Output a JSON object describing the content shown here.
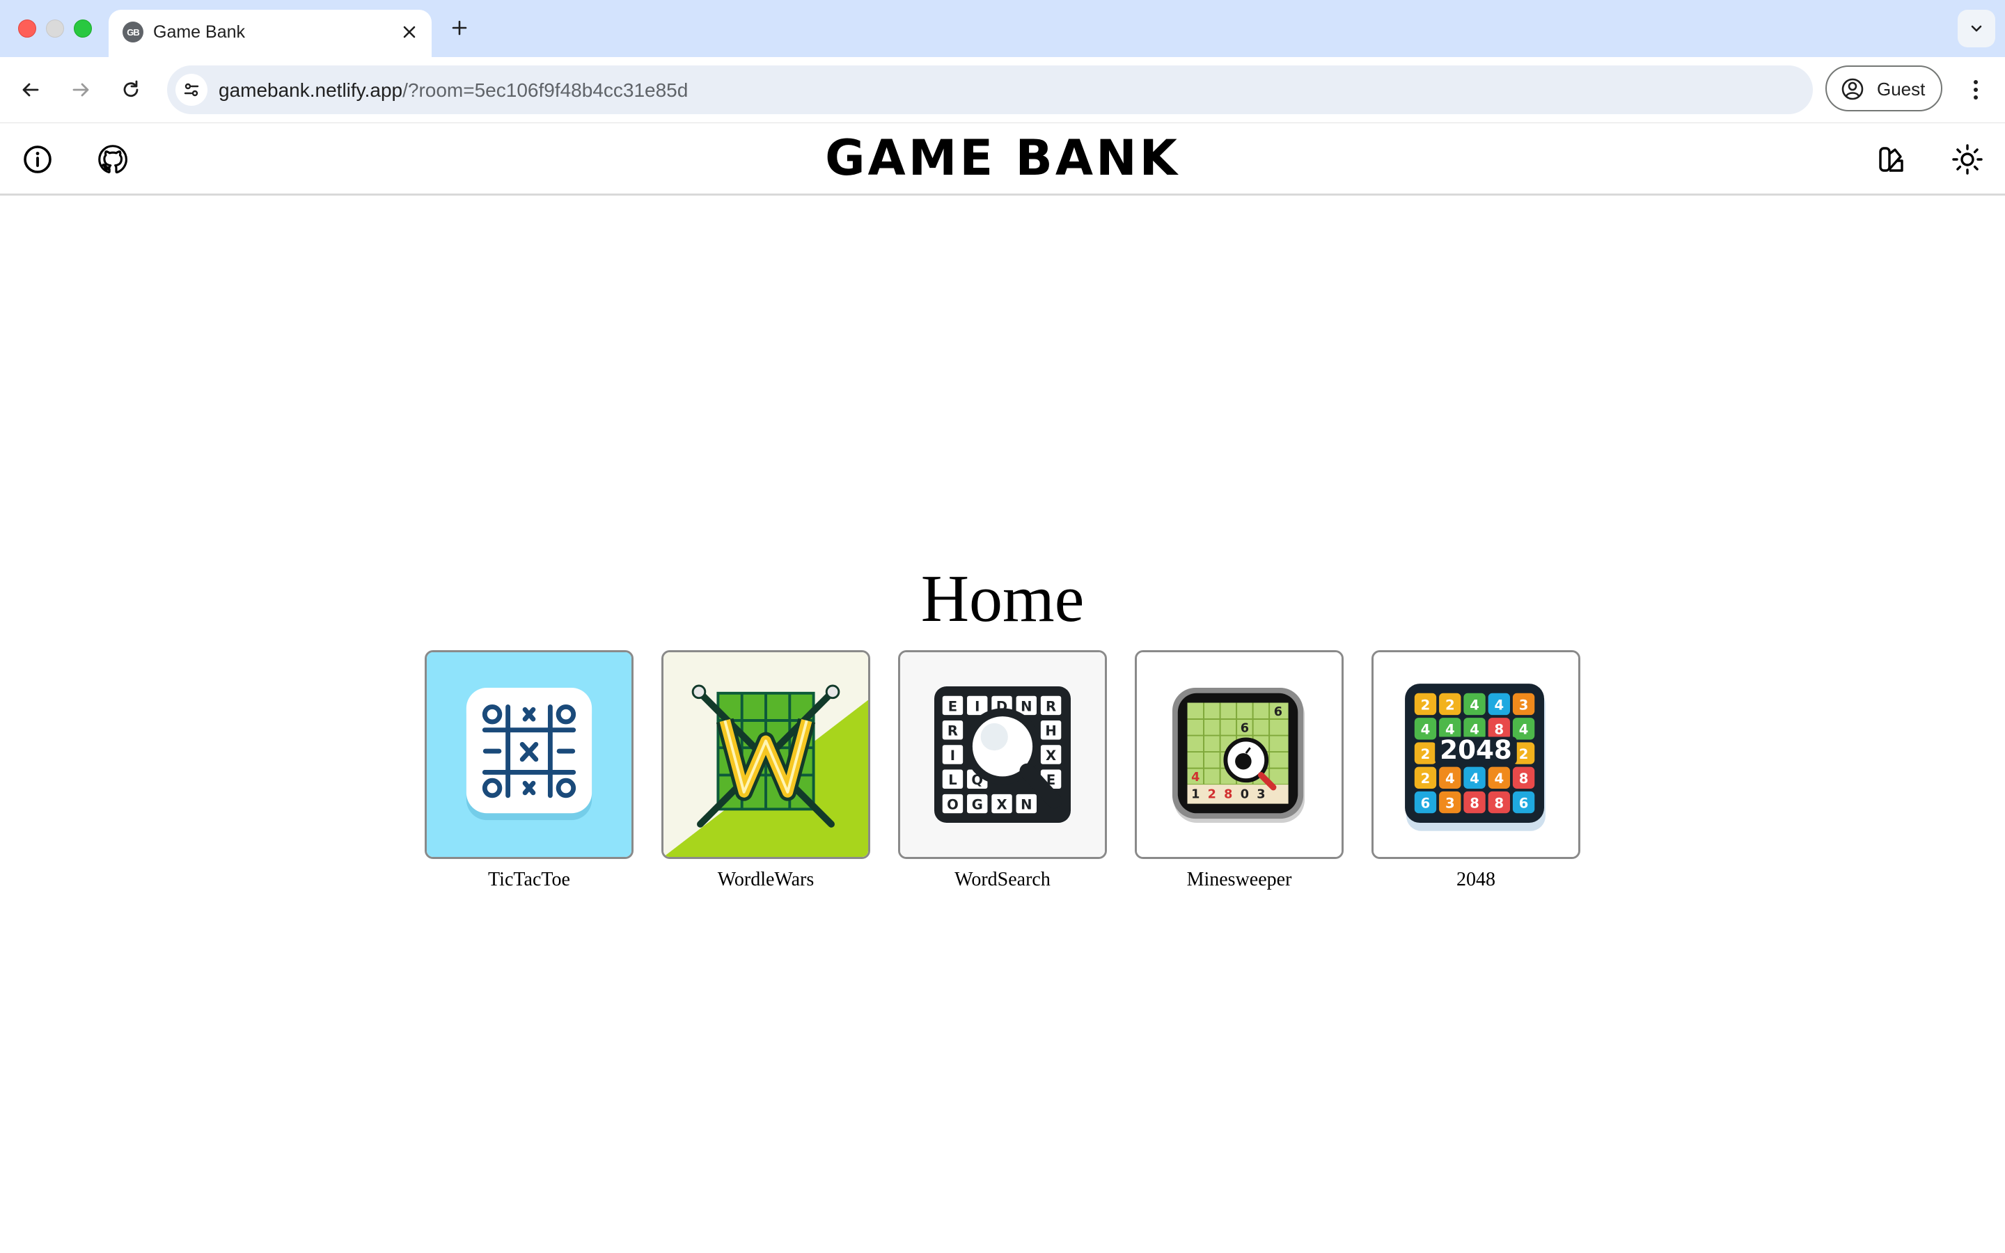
{
  "browser": {
    "tab_title": "Game Bank",
    "favicon_text": "GB",
    "url_host": "gamebank.netlify.app",
    "url_rest": "/?room=5ec106f9f48b4cc31e85d",
    "profile_label": "Guest"
  },
  "header": {
    "title": "GAME BANK"
  },
  "main": {
    "heading": "Home",
    "games": [
      {
        "label": "TicTacToe",
        "icon": "tictactoe-icon"
      },
      {
        "label": "WordleWars",
        "icon": "wordlewars-icon"
      },
      {
        "label": "WordSearch",
        "icon": "wordsearch-icon"
      },
      {
        "label": "Minesweeper",
        "icon": "minesweeper-icon"
      },
      {
        "label": "2048",
        "icon": "2048-icon"
      }
    ],
    "wordsearch_letters": [
      "E",
      "I",
      "D",
      "N",
      "R",
      "R",
      "H",
      "I",
      "X",
      "L",
      "E",
      "O",
      "Q",
      "G",
      "X",
      "N",
      "L"
    ],
    "minesweeper_numbers": [
      "6",
      "6",
      "4",
      "1",
      "2",
      "8",
      "0",
      "3"
    ],
    "tiles_2048": {
      "center": "2048",
      "rows": [
        [
          "2",
          "2",
          "4",
          "4",
          "3"
        ],
        [
          "4",
          "4",
          "4",
          "8",
          "4"
        ],
        [
          "2",
          "",
          "",
          "",
          "2"
        ],
        [
          "2",
          "4",
          "4",
          "4",
          "8"
        ],
        [
          "6",
          "3",
          "8",
          "8",
          "6"
        ]
      ]
    }
  },
  "colors": {
    "tictactoe_bg": "#8fe3fb",
    "wordle_green": "#a8d51c",
    "accent_blue": "#1a4a7a"
  }
}
